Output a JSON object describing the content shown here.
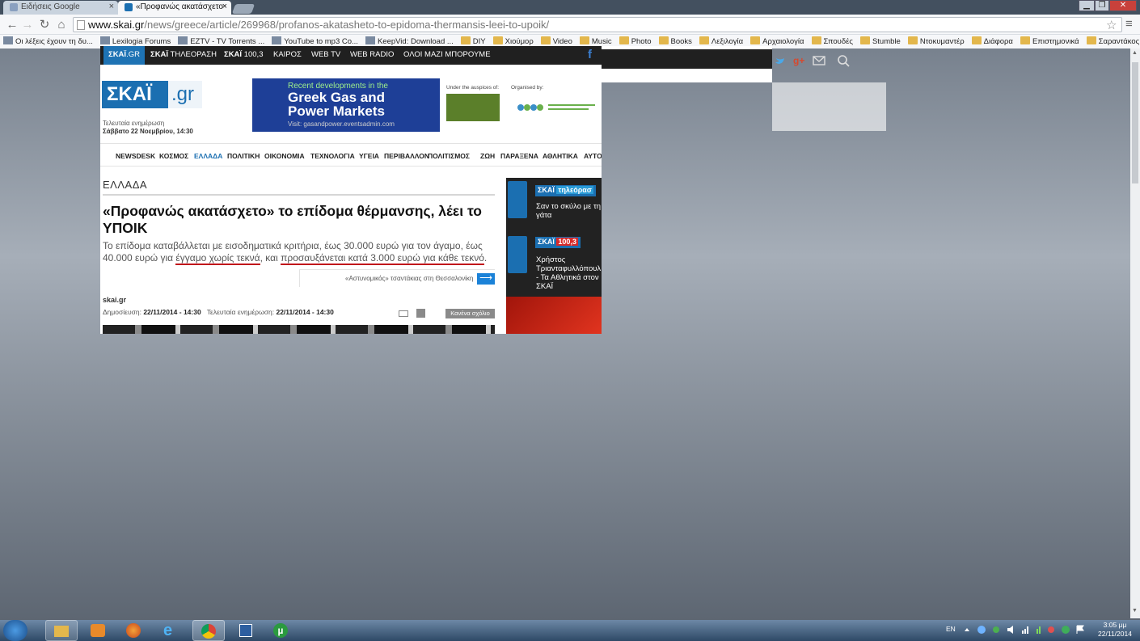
{
  "browser": {
    "tabs": [
      {
        "label": "Ειδήσεις Google",
        "icon": "google-news-icon",
        "active": false
      },
      {
        "label": "«Προφανώς ακατάσχετο",
        "icon": "skai-favicon-icon",
        "active": true
      }
    ],
    "url_host": "www.skai.gr",
    "url_path": "/news/greece/article/269968/profanos-akatasheto-to-epidoma-thermansis-leei-to-upoik/",
    "window_controls": [
      "minimize",
      "restore",
      "close"
    ],
    "bookmarks": [
      {
        "label": "Οι λέξεις έχουν τη δυ...",
        "icon": "site-icon"
      },
      {
        "label": "Lexilogia Forums",
        "icon": "lexilogia-icon"
      },
      {
        "label": "EZTV - TV Torrents ...",
        "icon": "eztv-icon"
      },
      {
        "label": "YouTube to mp3 Co...",
        "icon": "youtube-icon"
      },
      {
        "label": "KeepVid: Download ...",
        "icon": "keepvid-icon"
      },
      {
        "label": "DIY",
        "icon": "folder-icon"
      },
      {
        "label": "Χιούμορ",
        "icon": "folder-icon"
      },
      {
        "label": "Video",
        "icon": "folder-icon"
      },
      {
        "label": "Music",
        "icon": "folder-icon"
      },
      {
        "label": "Photo",
        "icon": "folder-icon"
      },
      {
        "label": "Books",
        "icon": "folder-icon"
      },
      {
        "label": "Λεξιλογία",
        "icon": "folder-icon"
      },
      {
        "label": "Αρχαιολογία",
        "icon": "folder-icon"
      },
      {
        "label": "Σπουδές",
        "icon": "folder-icon"
      },
      {
        "label": "Stumble",
        "icon": "folder-icon"
      },
      {
        "label": "Ντοκυμαντέρ",
        "icon": "folder-icon"
      },
      {
        "label": "Διάφορα",
        "icon": "folder-icon"
      },
      {
        "label": "Επιστημονικά",
        "icon": "folder-icon"
      },
      {
        "label": "Σαραντάκος",
        "icon": "folder-icon"
      }
    ]
  },
  "site": {
    "topnav": [
      {
        "strong": "ΣΚΑΪ",
        "rest": ".GR"
      },
      {
        "strong": "ΣΚΑΪ",
        "rest": " ΤΗΛΕΟΡΑΣΗ"
      },
      {
        "strong": "ΣΚΑΪ",
        "rest": " 100,3"
      },
      {
        "strong": "",
        "rest": "ΚΑΙΡΟΣ"
      },
      {
        "strong": "",
        "rest": "WEB TV"
      },
      {
        "strong": "",
        "rest": "WEB RADIO"
      },
      {
        "strong": "",
        "rest": "ΟΛΟΙ ΜΑΖΙ ΜΠΟΡΟΥΜΕ"
      }
    ],
    "logo_main": "ΣΚΑΪ",
    "logo_suffix": ".gr",
    "updated_label": "Τελευταία ενημέρωση",
    "updated_date": "Σάββατο 22 Νοεμβρίου, 14:30",
    "banner": {
      "line1": "Recent developments in the",
      "line2": "Greek Gas and",
      "line3": "Power Markets",
      "line4": "Visit: gasandpower.eventsadmin.com",
      "auspices": "Under the auspices of:",
      "organised": "Organised by:"
    },
    "categories": [
      "NEWSDESK",
      "ΚΟΣΜΟΣ",
      "ΕΛΛΑΔΑ",
      "ΠΟΛΙΤΙΚΗ",
      "ΟΙΚΟΝΟΜΙΑ",
      "ΤΕΧΝΟΛΟΓΙΑ",
      "ΥΓΕΙΑ",
      "ΠΕΡΙΒΑΛΛΟΝ",
      "ΠΟΛΙΤΙΣΜΟΣ",
      "ΖΩΗ",
      "ΠΑΡΑΞΕΝΑ",
      "ΑΘΛΗΤΙΚΑ",
      "ΑΥΤΟ"
    ],
    "active_category": "ΕΛΛΑΔΑ",
    "accent_color": "#1b6fb1",
    "underline_color": "#c0101a",
    "article": {
      "section": "ΕΛΛΑΔΑ",
      "headline": "«Προφανώς ακατάσχετο» το επίδομα θέρμανσης, λέει το ΥΠΟΙΚ",
      "lede_1": "Το επίδομα καταβάλλεται με εισοδηματικά κριτήρια, έως 30.000 ευρώ για τον άγαμο, έως 40.000 ευρώ για ",
      "lede_u1": "έγγαμο χωρίς τεκνά",
      "lede_2": ", και ",
      "lede_u2": "προσαυξάνεται κατά 3.000 ευρώ για κάθε τεκνό",
      "lede_3": ".",
      "next_link": "«Αστυνομικός» τσαντάκιας στη Θεσσαλονίκη",
      "source": "skai.gr",
      "published_label": "Δημοσίευση: ",
      "published": "22/11/2014 - 14:30",
      "updated_label": "Τελευταία ενημέρωση: ",
      "updated": "22/11/2014 - 14:30",
      "comments": "Κανένα σχόλιο"
    },
    "sidebar": [
      {
        "badge_strong": "ΣΚΑΪ",
        "badge_rest": "τηλεόρασ",
        "text": "Σαν το σκύλο με τη γάτα"
      },
      {
        "badge_strong": "ΣΚΑΪ",
        "badge_rest": "100,3",
        "text": "Χρήστος Τριανταφυλλόπουλ - Τα Αθλητικά στον ΣΚΑΪ"
      }
    ]
  },
  "taskbar": {
    "lang": "EN",
    "time": "3:05 μμ",
    "date": "22/11/2014"
  }
}
